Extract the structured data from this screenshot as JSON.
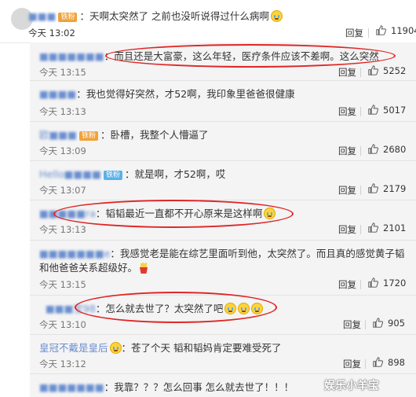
{
  "top_comment": {
    "user": "■■■",
    "badge": "铁粉",
    "text": "：天啊太突然了 之前也没听说得过什么病啊",
    "time": "今天 13:02",
    "reply": "回复",
    "likes": "11904"
  },
  "replies": [
    {
      "user": "■■■■■■■",
      "badge": "",
      "text": "：而且还是大富豪，这么年轻，医疗条件应该不差啊。这么突然",
      "time": "今天 13:15",
      "reply": "回复",
      "likes": "5252"
    },
    {
      "user": "■■■■",
      "badge": "",
      "text": "：我也觉得好突然，才52啊，我印象里爸爸很健康",
      "time": "今天 13:13",
      "reply": "回复",
      "likes": "5017"
    },
    {
      "user": "欧■■■",
      "badge": "铁粉",
      "text": "：卧槽，我整个人懵逼了",
      "time": "今天 13:09",
      "reply": "回复",
      "likes": "2680"
    },
    {
      "user": "Hello■■■■",
      "badge": "铁粉",
      "text": "：就是啊，才52啊，哎",
      "time": "今天 13:07",
      "reply": "回复",
      "likes": "2179"
    },
    {
      "user": "■■■■■ra",
      "badge": "",
      "text": "：韬韬最近一直都不开心原来是这样啊",
      "time": "今天 13:13",
      "reply": "回复",
      "likes": "2101"
    },
    {
      "user": "■■■■■■■e",
      "badge": "",
      "text": "：我感觉老是能在综艺里面听到他，太突然了。而且真的感觉黄子韬和他爸爸关系超级好。",
      "time": "今天 13:15",
      "reply": "回复",
      "likes": "1720"
    },
    {
      "user": "■■■宝98",
      "badge": "",
      "text": "：怎么就去世了？太突然了吧",
      "time": "今天 13:10",
      "reply": "回复",
      "likes": "905"
    },
    {
      "user": "皇冠不戴是皇后",
      "badge": "",
      "text": "：苍了个天 韬和韬妈肯定要难受死了",
      "time": "今天 13:12",
      "reply": "回复",
      "likes": "898"
    },
    {
      "user": "■■■■■■■",
      "badge": "",
      "text": "：我靠？？？怎么回事 怎么就去世了！！！",
      "time": "",
      "reply": "",
      "likes": ""
    }
  ],
  "watermark": "娱乐小羊宝",
  "colors": {
    "highlight_ring": "#e02626",
    "username": "#eb7350",
    "panel_bg": "#f4f4f4"
  },
  "icons": {
    "like": "thumbs-up-icon",
    "emoji": "crying-face-icon"
  }
}
